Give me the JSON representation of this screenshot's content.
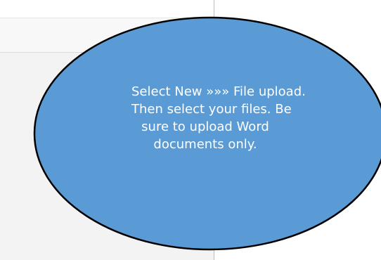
{
  "callout": {
    "lines": [
      "Select New »»» File upload.",
      "Then select your files. Be",
      "sure to upload Word",
      "documents only."
    ],
    "fill_color": "#5b9bd5",
    "stroke_color": "#000000"
  }
}
